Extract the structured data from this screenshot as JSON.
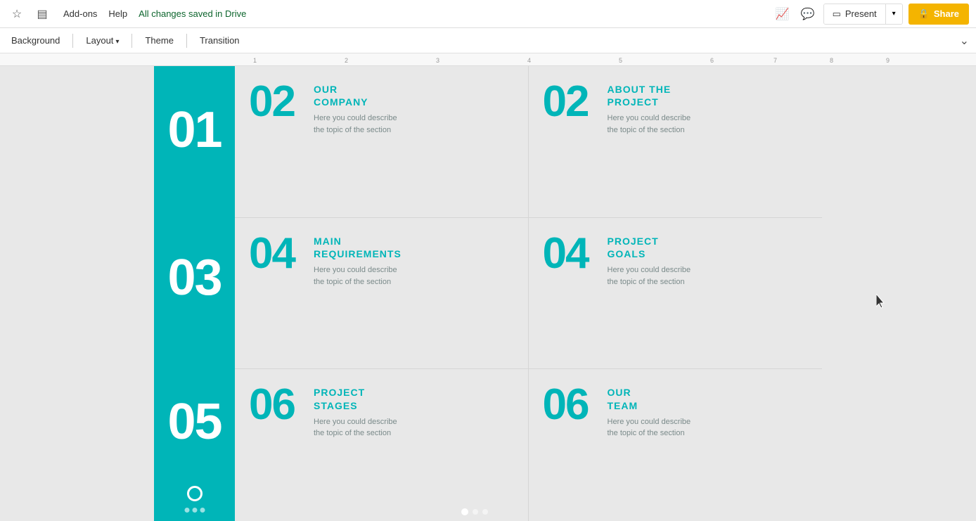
{
  "topbar": {
    "addons_label": "Add-ons",
    "help_label": "Help",
    "save_status": "All changes saved in Drive",
    "present_label": "Present",
    "share_label": "Share",
    "share_icon": "🔒"
  },
  "formatbar": {
    "background_label": "Background",
    "layout_label": "Layout",
    "theme_label": "Theme",
    "transition_label": "Transition"
  },
  "slide": {
    "sections": [
      {
        "number": "01",
        "title": "OUR\nCOMPANY",
        "description": "Here you could describe\nthe topic of the section"
      },
      {
        "number": "02",
        "title": "ABOUT THE\nPROJECT",
        "description": "Here you could describe\nthe topic of the section"
      },
      {
        "number": "03",
        "title": "MAIN\nREQUIREMENTS",
        "description": "Here you could describe\nthe topic of the section"
      },
      {
        "number": "04",
        "title": "PROJECT\nGOALS",
        "description": "Here you could describe\nthe topic of the section"
      },
      {
        "number": "05",
        "title": "PROJECT\nSTAGES",
        "description": "Here you could describe\nthe topic of the section"
      },
      {
        "number": "06",
        "title": "OUR\nTEAM",
        "description": "Here you could describe\nthe topic of the section"
      }
    ],
    "bar_numbers": [
      "01",
      "03",
      "05"
    ]
  },
  "colors": {
    "teal": "#00b5b8",
    "share_bg": "#f4b400",
    "text_light": "#7a8a8a"
  }
}
